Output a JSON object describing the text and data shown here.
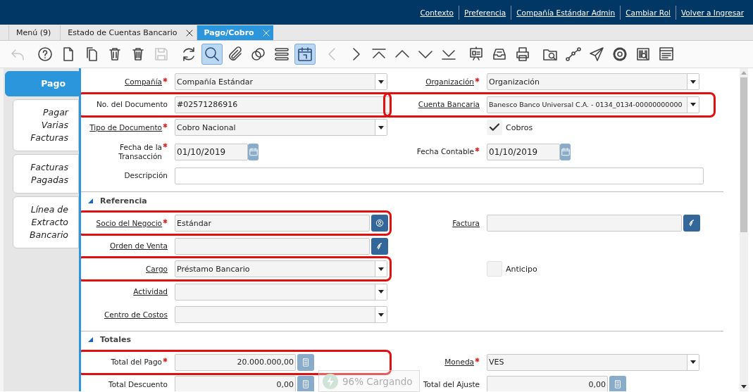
{
  "header_links": [
    "Contexto",
    "Preferencia",
    "Compañía Estándar Admin",
    "Cambiar Rol",
    "Volver a Ingresar"
  ],
  "tabs": [
    {
      "label": "Menú (9)",
      "selected": false,
      "closable": false
    },
    {
      "label": "Estado de Cuentas Bancario",
      "selected": false,
      "closable": true
    },
    {
      "label": "Pago/Cobro",
      "selected": true,
      "closable": true
    }
  ],
  "toolbar": [
    {
      "disabled": true,
      "selected": false
    },
    {
      "disabled": false,
      "selected": false
    },
    {
      "disabled": false,
      "selected": false
    },
    {
      "disabled": false,
      "selected": false
    },
    {
      "disabled": false,
      "selected": false
    },
    {
      "disabled": false,
      "selected": false
    },
    {
      "disabled": true,
      "selected": false
    },
    {
      "disabled": false,
      "selected": false
    },
    {
      "disabled": false,
      "selected": true
    },
    {
      "disabled": false,
      "selected": false
    },
    {
      "disabled": false,
      "selected": false
    },
    {
      "disabled": false,
      "selected": false
    },
    {
      "disabled": false,
      "selected": true
    },
    {
      "disabled": true,
      "selected": false
    },
    {
      "disabled": false,
      "selected": false
    },
    {
      "disabled": false,
      "selected": false
    },
    {
      "disabled": false,
      "selected": false
    },
    {
      "disabled": false,
      "selected": false
    },
    {
      "disabled": false,
      "selected": false
    },
    {
      "disabled": false,
      "selected": false
    },
    {
      "disabled": false,
      "selected": false
    },
    {
      "disabled": false,
      "selected": false
    },
    {
      "disabled": false,
      "selected": false
    },
    {
      "disabled": false,
      "selected": false
    },
    {
      "disabled": false,
      "selected": false
    },
    {
      "disabled": false,
      "selected": false
    },
    {
      "disabled": false,
      "selected": false
    },
    {
      "disabled": false,
      "selected": false
    }
  ],
  "side_tabs": [
    {
      "label": "Pago",
      "selected": true
    },
    {
      "label": "Pagar Varias Facturas",
      "selected": false
    },
    {
      "label": "Facturas Pagadas",
      "selected": false
    },
    {
      "label": "Línea de Extracto Bancario",
      "selected": false
    }
  ],
  "sections": [
    {
      "rows": [
        {
          "left": {
            "label": "Compañía",
            "kind": "combo",
            "required": true,
            "link": true,
            "value": "Compañía Estándar",
            "highlighted": false
          },
          "right": {
            "label": "Organización",
            "kind": "combo",
            "required": true,
            "link": true,
            "value": "Organización",
            "highlighted": false
          }
        },
        {
          "left": {
            "label": "No. del Documento",
            "kind": "text",
            "required": false,
            "link": false,
            "value": "#02571286916",
            "highlighted": true
          },
          "right": {
            "label": "Cuenta Bancaria",
            "kind": "combo",
            "required": false,
            "link": true,
            "value": "Banesco Banco Universal C.A. - 0134_0134-00000000000",
            "highlighted": true
          }
        },
        {
          "left": {
            "label": "Tipo de Documento",
            "kind": "combo",
            "required": true,
            "link": true,
            "value": "Cobro Nacional",
            "highlighted": false
          },
          "right": {
            "label": "Cobros",
            "kind": "checkbox",
            "checked": true,
            "highlighted": false
          }
        },
        {
          "left": {
            "label": "Fecha de la Transacción",
            "kind": "date",
            "required": true,
            "link": false,
            "value": "01/10/2019",
            "highlighted": false
          },
          "right": {
            "label": "Fecha Contable",
            "kind": "date",
            "required": true,
            "link": false,
            "value": "01/10/2019",
            "highlighted": false
          }
        },
        {
          "full": {
            "label": "Descripción",
            "kind": "text",
            "required": false,
            "link": false,
            "highlighted": false
          }
        }
      ]
    },
    {
      "title": "Referencia",
      "expanded": true,
      "rows": [
        {
          "left": {
            "label": "Socio del Negocio",
            "kind": "partner",
            "required": true,
            "link": true,
            "value": "Estándar",
            "highlighted": true
          },
          "right": {
            "label": "Factura",
            "kind": "lookup",
            "required": false,
            "link": true,
            "highlighted": false
          }
        },
        {
          "left": {
            "label": "Orden de Venta",
            "kind": "lookup",
            "required": false,
            "link": true,
            "highlighted": false
          }
        },
        {
          "left": {
            "label": "Cargo",
            "kind": "combo",
            "required": false,
            "link": true,
            "value": "Préstamo Bancario",
            "highlighted": true
          },
          "right": {
            "label": "Anticipo",
            "kind": "checkbox",
            "checked": false,
            "highlighted": false
          }
        },
        {
          "left": {
            "label": "Actividad",
            "kind": "combo",
            "required": false,
            "link": true,
            "highlighted": false
          }
        },
        {
          "left": {
            "label": "Centro de Costos",
            "kind": "combo",
            "required": false,
            "link": true,
            "highlighted": false
          }
        }
      ]
    },
    {
      "title": "Totales",
      "expanded": true,
      "rows": [
        {
          "left": {
            "label": "Total del Pago",
            "kind": "number",
            "required": true,
            "link": false,
            "value": "20.000.000,00",
            "highlighted": true
          },
          "right": {
            "label": "Moneda",
            "kind": "combo",
            "required": true,
            "link": true,
            "value": "VES",
            "highlighted": false
          }
        },
        {
          "left": {
            "label": "Total Descuento",
            "kind": "number",
            "required": false,
            "link": false,
            "value": "0,00",
            "highlighted": false
          },
          "right": {
            "label": "Total del Ajuste",
            "kind": "number",
            "required": false,
            "link": false,
            "value": "0,00",
            "highlighted": false
          }
        }
      ]
    }
  ],
  "loading_toast": {
    "text": "96% Cargando"
  }
}
